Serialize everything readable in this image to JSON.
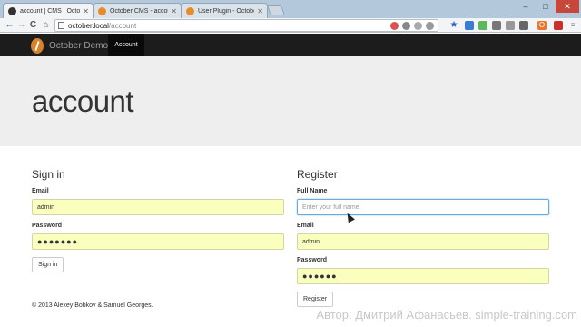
{
  "browser": {
    "tabs": [
      {
        "title": "account | CMS | October",
        "favicon": "github-icon"
      },
      {
        "title": "October CMS - account",
        "favicon": "october-icon"
      },
      {
        "title": "User Plugin - October CM",
        "favicon": "october-icon"
      }
    ],
    "address": {
      "host": "october.local",
      "path": "/account"
    },
    "window_controls": {
      "minimize": "–",
      "maximize": "□",
      "close": "✕"
    },
    "nav_glyphs": {
      "back": "←",
      "forward": "→",
      "reload": "C",
      "home": "⌂"
    },
    "star_glyph": "★",
    "ext_glyph": "O"
  },
  "site": {
    "brand": "October Demo",
    "nav": {
      "account": "Account"
    },
    "page_title": "account",
    "signin": {
      "heading": "Sign in",
      "email_label": "Email",
      "email_value": "admin",
      "password_label": "Password",
      "password_value": "●●●●●●●",
      "button": "Sign in"
    },
    "register": {
      "heading": "Register",
      "name_label": "Full Name",
      "name_placeholder": "Enter your full name",
      "email_label": "Email",
      "email_value": "admin",
      "password_label": "Password",
      "password_value": "●●●●●●",
      "button": "Register"
    },
    "footer": "© 2013 Alexey Bobkov & Samuel Georges.",
    "watermark": "Автор: Дмитрий Афанасьев. simple-training.com"
  },
  "colors": {
    "navbar": "#1c1c1c",
    "brand_logo": "#d9822b",
    "jumbotron": "#eeeeee",
    "autofill": "#faffbd"
  }
}
